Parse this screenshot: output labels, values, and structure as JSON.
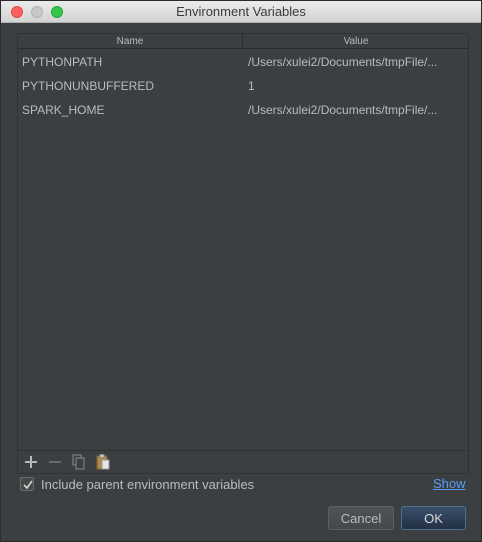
{
  "window": {
    "title": "Environment Variables"
  },
  "table": {
    "columns": {
      "name": "Name",
      "value": "Value"
    },
    "rows": [
      {
        "name": "PYTHONPATH",
        "value": "/Users/xulei2/Documents/tmpFile/..."
      },
      {
        "name": "PYTHONUNBUFFERED",
        "value": "1"
      },
      {
        "name": "SPARK_HOME",
        "value": "/Users/xulei2/Documents/tmpFile/..."
      }
    ]
  },
  "toolbar": {
    "add_icon": "plus-icon",
    "remove_icon": "minus-icon",
    "copy_icon": "copy-icon",
    "paste_icon": "paste-icon"
  },
  "options": {
    "include_parent_label": "Include parent environment variables",
    "include_parent_checked": true,
    "show_link": "Show"
  },
  "buttons": {
    "cancel": "Cancel",
    "ok": "OK"
  },
  "colors": {
    "background": "#3c3f41",
    "text": "#bbbbbb",
    "link": "#589df6",
    "ok_button": "#2f4560"
  }
}
